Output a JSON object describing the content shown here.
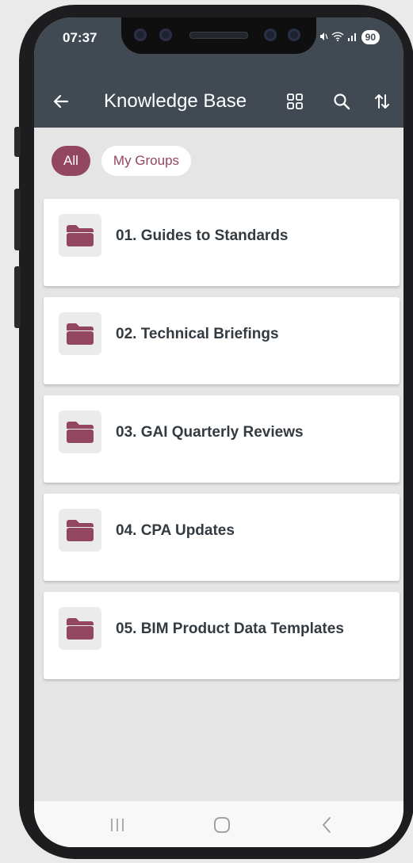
{
  "status_bar": {
    "time": "07:37",
    "battery": "90"
  },
  "toolbar": {
    "title": "Knowledge Base",
    "icons": [
      "back-arrow-icon",
      "grid-view-icon",
      "search-icon",
      "sort-icon"
    ]
  },
  "filters": {
    "all_label": "All",
    "my_groups_label": "My Groups",
    "selected": "All"
  },
  "folders": [
    {
      "title": "01. Guides to Standards",
      "icon": "folder-icon"
    },
    {
      "title": "02. Technical Briefings",
      "icon": "folder-icon"
    },
    {
      "title": "03. GAI Quarterly Reviews",
      "icon": "folder-icon"
    },
    {
      "title": "04. CPA Updates",
      "icon": "folder-icon"
    },
    {
      "title": "05. BIM Product Data Templates",
      "icon": "folder-icon"
    }
  ],
  "nav_bar": {
    "icons": [
      "recent-apps-icon",
      "home-icon",
      "back-icon"
    ]
  },
  "colors": {
    "header": "#414a52",
    "accent": "#934660",
    "background": "#e5e5e5",
    "card": "#ffffff",
    "card_text": "#333a40"
  }
}
